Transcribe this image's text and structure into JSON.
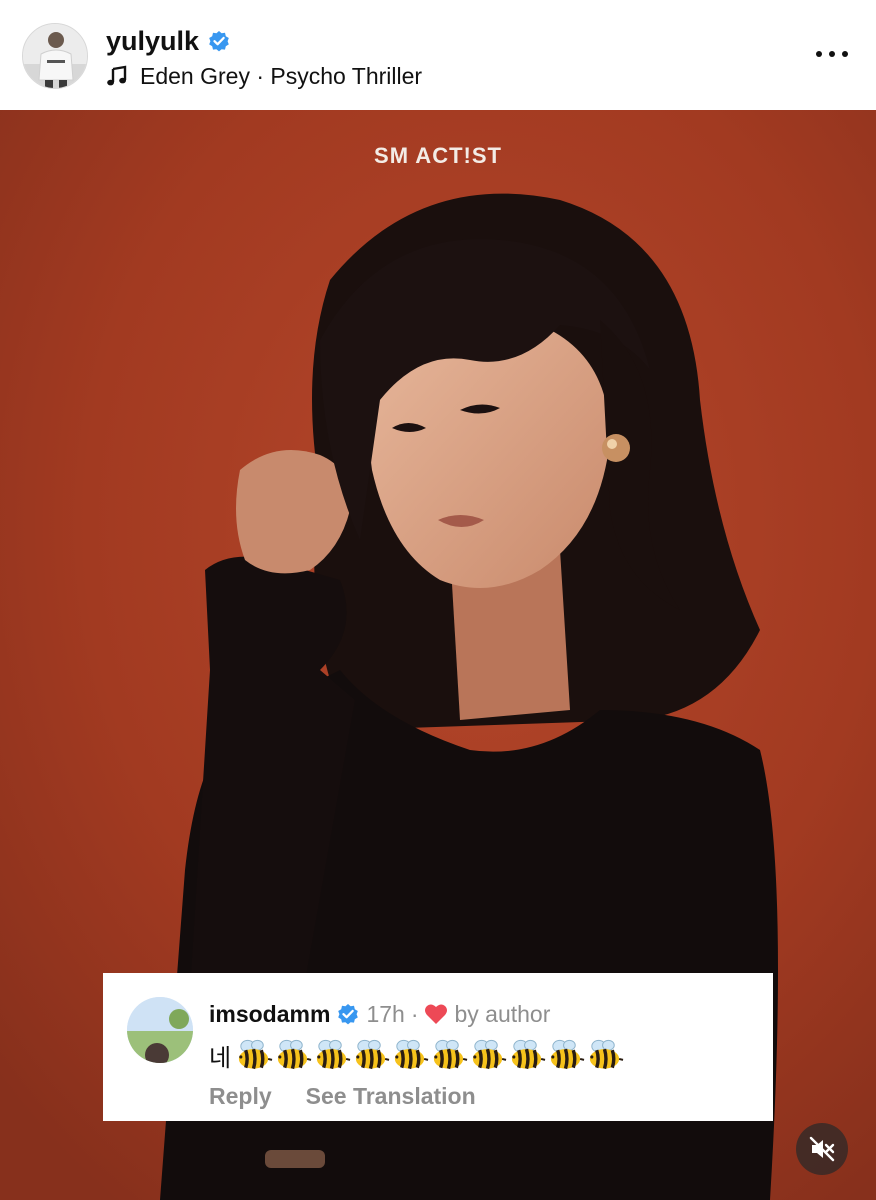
{
  "post": {
    "username": "yulyulk",
    "verified": true,
    "music": "Eden Grey · Psycho Thriller",
    "more_icon": "more-horizontal-icon"
  },
  "photo": {
    "brand_text": "SM ACT!ST",
    "background_color": "#a53b22"
  },
  "comment": {
    "username": "imsodamm",
    "verified": true,
    "time": "17h",
    "separator": "·",
    "liked_by": "by author",
    "text": "네",
    "emoji": "bee",
    "emoji_count": 10,
    "actions": {
      "reply": "Reply",
      "translate": "See Translation"
    }
  },
  "media_controls": {
    "mute_icon": "speaker-muted-icon"
  },
  "colors": {
    "verified_blue": "#3897f0",
    "heart_red": "#ed4956",
    "meta_gray": "#8e8e8e"
  }
}
